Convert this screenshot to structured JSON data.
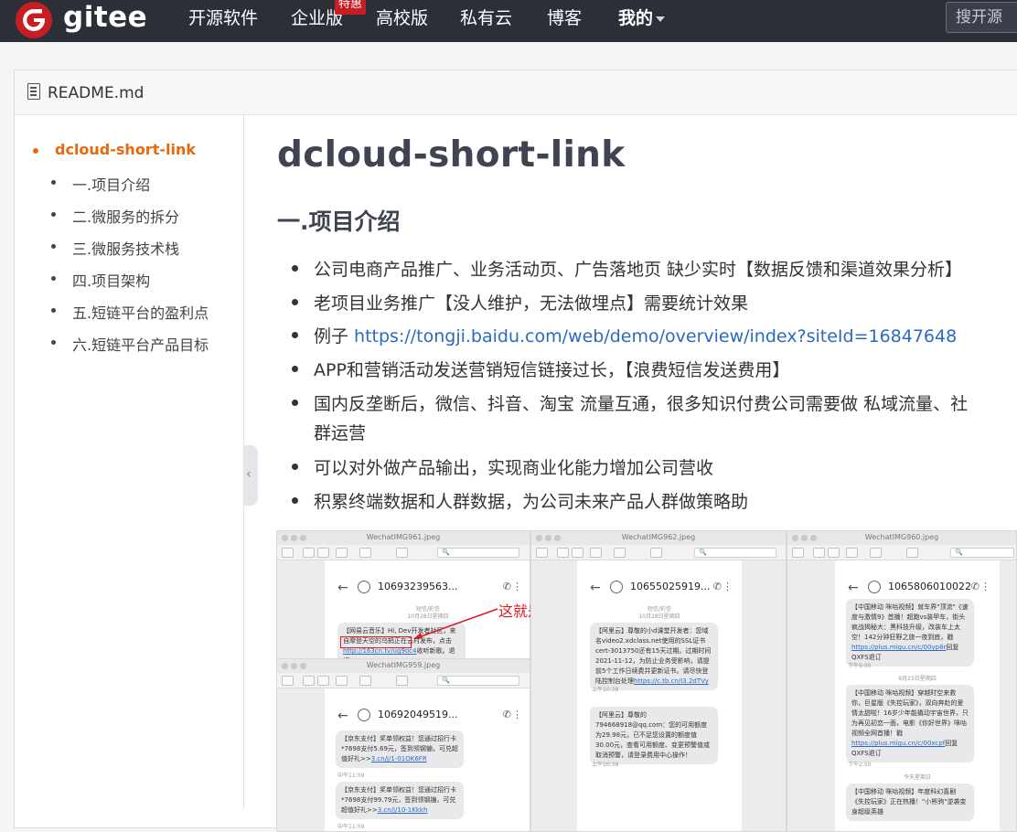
{
  "brand": {
    "name": "gitee",
    "logo_color": "#c71d23"
  },
  "nav": {
    "items": [
      "开源软件",
      "企业版",
      "高校版",
      "私有云",
      "博客"
    ],
    "user_menu": "我的",
    "badge": "特惠",
    "search_placeholder": "搜开源"
  },
  "file": {
    "name": "README.md"
  },
  "toc": {
    "root": "dcloud-short-link",
    "items": [
      "一.项目介绍",
      "二.微服务的拆分",
      "三.微服务技术栈",
      "四.项目架构",
      "五.短链平台的盈利点",
      "六.短链平台产品目标"
    ]
  },
  "content": {
    "title": "dcloud-short-link",
    "section": "一.项目介绍",
    "bullets": [
      "公司电商产品推广、业务活动页、广告落地页 缺少实时【数据反馈和渠道效果分析】",
      "老项目业务推广【没人维护，无法做埋点】需要统计效果",
      "例子 ",
      "APP和营销活动发送营销短信链接过长，【浪费短信发送费用】",
      "国内反垄断后，微信、抖音、淘宝 流量互通，很多知识付费公司需要做 私域流量、社",
      "群运营",
      "可以对外做产品输出，实现商业化能力增加公司营收",
      "积累终端数据和人群数据，为公司未来产品人群做策略助"
    ],
    "example_link": "https://tongji.baidu.com/web/demo/overview/index?siteId=16847648"
  },
  "image": {
    "annotation": "这就是短链",
    "windows": [
      {
        "title": "WechatIMG961.jpeg",
        "number": "10693239563...",
        "date": "10月28日星期四"
      },
      {
        "title": "WechatIMG962.jpeg",
        "number": "10655025919...",
        "date": "10月28日星期四"
      },
      {
        "title": "WechatIMG960.jpeg",
        "number": "1065806010022"
      },
      {
        "title": "WechatIMG959.jpeg",
        "number": "10692049519..."
      }
    ],
    "sms": {
      "a1": "【网易云音乐】Hi, Dev开发者社区，来自摩登天空的乌鸫正在云村发布，点击",
      "a1_link": "http://163cn.tv/ug9oc4",
      "a1_tail": "收听新歌。退订TD",
      "b1": "【阿里云】尊敬的小d课堂开发者：您域名video2.xdclass.net使用的SSL证书cert-3013750还有15天过期。过期时间2021-11-12，为防止业务受影响，请提前5个工作日续费并更新证书。请尽快登陆控制台处理",
      "b1_link": "https://c.tb.cn/I3.2dTVy",
      "b2": "【阿里云】尊敬的794668918@qq.com：您的可用额度为29.98元，已不足您设置的额度值30.00元，查看可用额度、变更预警值或取消预警，请登录费用中心操作！",
      "c1": "【中国移动 咪咕视频】就车界\"顶流\"《速度与激情9》首播！超跑vs装甲车，街头疯战揭秘大：黑科技升级，改装车上太空！142分钟狂野之旅一夜到底，戳",
      "c1_link": "https://plus.migu.cn/c/00yp8r",
      "c1_tail": "回复QXFS退订",
      "c2": "【中国移动 咪咕视频】穿越时空来救你，巨星版《失控玩家》，双向奔赴的爱情太甜啦！16岁少年能撬动宇宙世界，只为再见初恋一面，电影《你好世界》咪咕视频全网首播！戳",
      "c2_link": "https://plus.migu.cn/c/00xcpf",
      "c2_tail": "回复QXFS退订",
      "c3": "【中国移动 咪咕视频】年度科幻喜剧《失控玩家》正在热播！\"小熊驹\"逆袭变身超级英雄",
      "d1": "【京东支付】奖单领权益！您通过招行卡*7698支付5.69元，签到领钢镚，可兑超值好礼>>",
      "d1_link": "3.cn/j/1-01OK6FR",
      "d2": "【京东支付】奖单领权益！您通过招行卡*7698支付99.79元，签到领钢镚，可兑超值好礼>>",
      "d2_link": "3.cn/j/10-1Kkkh"
    },
    "times": [
      "上午10:38",
      "上午10:38",
      "下午9:00",
      "下午2:50",
      "中午11:59",
      "中午11:59",
      "9月23日星期四"
    ],
    "labels": {
      "sms_label": "短信/彩信",
      "today": "今天星期日"
    }
  }
}
